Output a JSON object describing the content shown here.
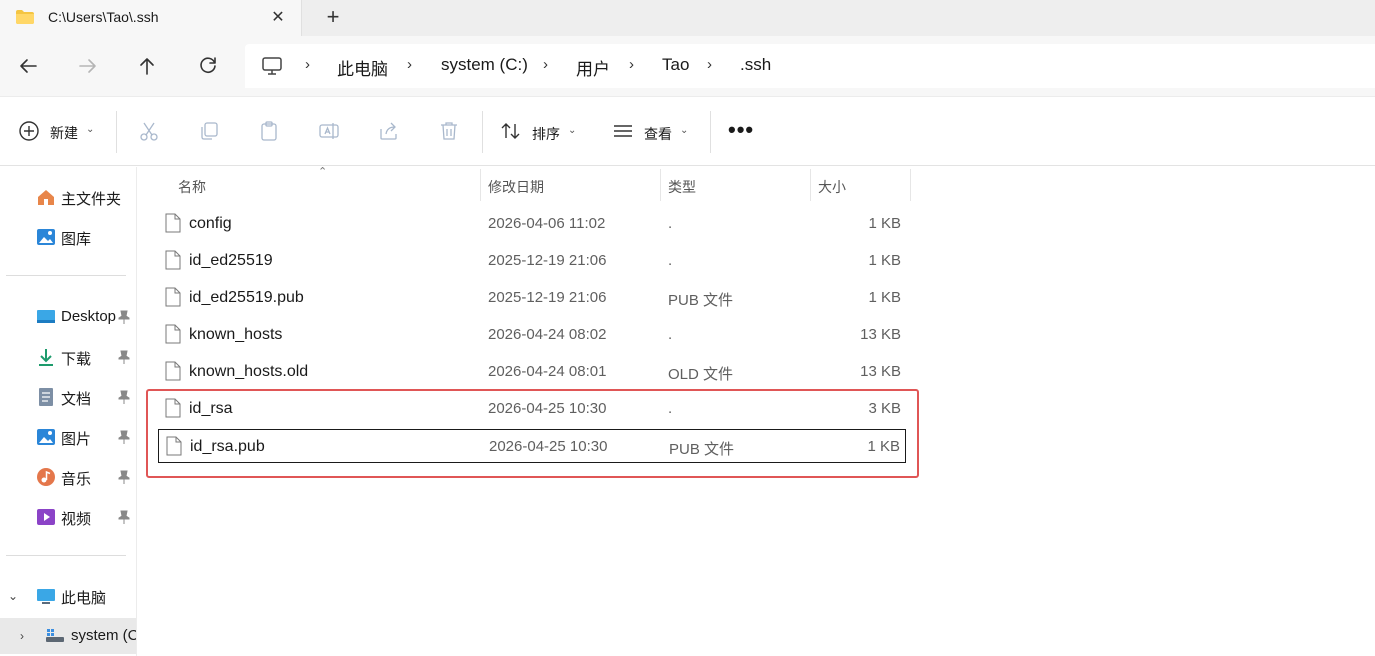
{
  "tab": {
    "title": "C:\\Users\\Tao\\.ssh",
    "close": "✕",
    "new_tab": "+",
    "folder_icon": "folder-icon"
  },
  "breadcrumbs": [
    "此电脑",
    "system (C:)",
    "用户",
    "Tao",
    ".ssh"
  ],
  "breadcrumb_separator": "›",
  "toolbar": {
    "new_label": "新建",
    "sort_label": "排序",
    "view_label": "查看",
    "more_label": "•••",
    "caret": "⌄"
  },
  "sidebar": {
    "quick": [
      {
        "label": "主文件夹",
        "icon": "home-icon"
      },
      {
        "label": "图库",
        "icon": "gallery-icon"
      }
    ],
    "pinned": [
      {
        "label": "Desktop",
        "icon": "desktop-icon"
      },
      {
        "label": "下载",
        "icon": "download-icon"
      },
      {
        "label": "文档",
        "icon": "document-icon"
      },
      {
        "label": "图片",
        "icon": "pictures-icon"
      },
      {
        "label": "音乐",
        "icon": "music-icon"
      },
      {
        "label": "视频",
        "icon": "video-icon"
      }
    ],
    "this_pc": {
      "label": "此电脑",
      "expander": "⌄"
    },
    "drive": {
      "label": "system (C:)",
      "expander": "›"
    }
  },
  "columns": {
    "name": "名称",
    "date": "修改日期",
    "type": "类型",
    "size": "大小",
    "sort_indicator": "⌃"
  },
  "files": [
    {
      "name": "config",
      "date": "2026-04-06 11:02",
      "type": ".",
      "size": "1 KB"
    },
    {
      "name": "id_ed25519",
      "date": "2025-12-19 21:06",
      "type": ".",
      "size": "1 KB"
    },
    {
      "name": "id_ed25519.pub",
      "date": "2025-12-19 21:06",
      "type": "PUB 文件",
      "size": "1 KB"
    },
    {
      "name": "known_hosts",
      "date": "2026-04-24 08:02",
      "type": ".",
      "size": "13 KB"
    },
    {
      "name": "known_hosts.old",
      "date": "2026-04-24 08:01",
      "type": "OLD 文件",
      "size": "13 KB"
    },
    {
      "name": "id_rsa",
      "date": "2026-04-25 10:30",
      "type": ".",
      "size": "3 KB"
    },
    {
      "name": "id_rsa.pub",
      "date": "2026-04-25 10:30",
      "type": "PUB 文件",
      "size": "1 KB"
    }
  ],
  "colors": {
    "highlight_box": "#e05656",
    "folder": "#f4c542",
    "accent": "#0a64c8"
  }
}
